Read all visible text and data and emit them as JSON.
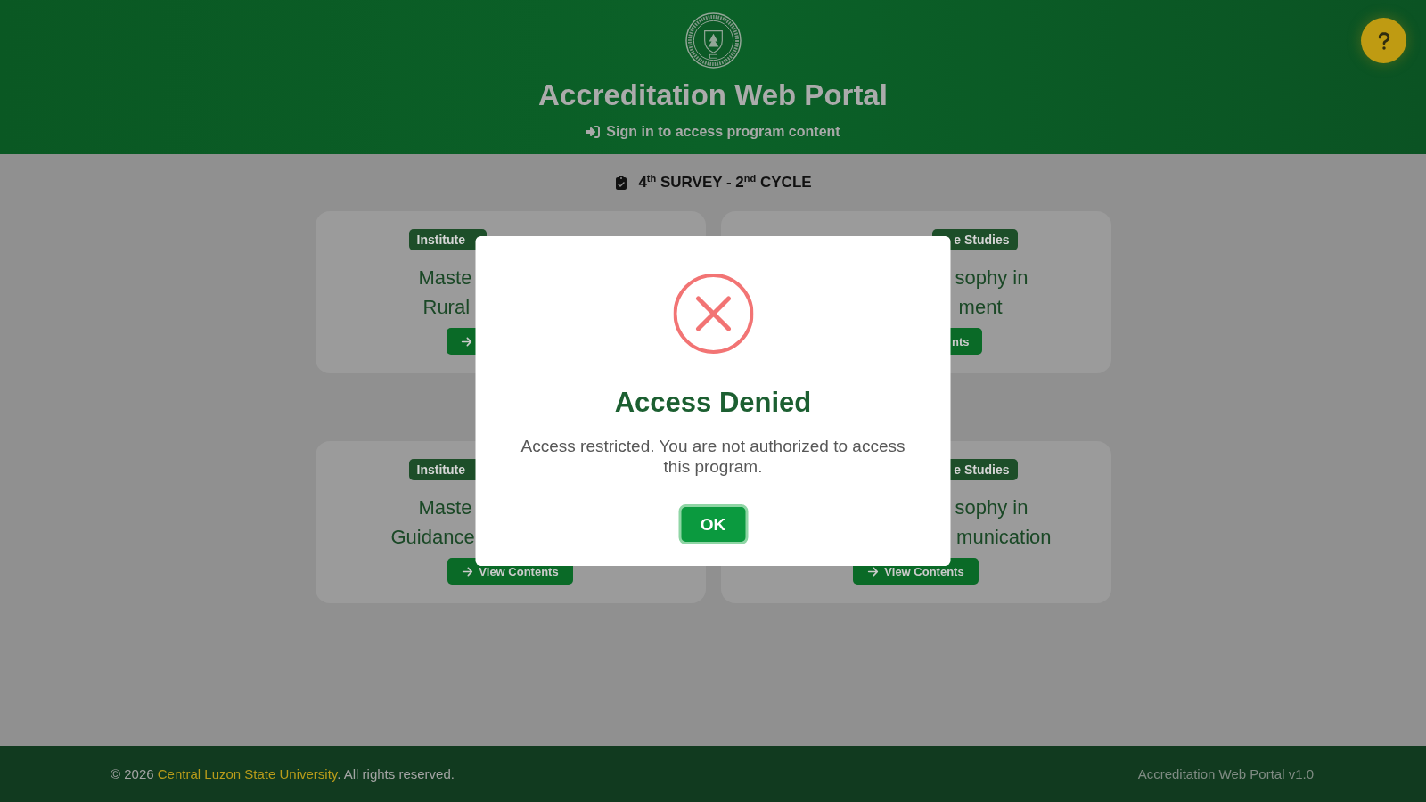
{
  "header": {
    "title": "Accreditation Web Portal",
    "subtitle": "Sign in to access program content"
  },
  "survey_heading": "4$^{th}$ SURVEY - 2$^{nd}$ CYCLE",
  "cards": [
    {
      "badge": "Institute",
      "title_lines": [
        "Maste",
        "Rural"
      ]
    },
    {
      "badge": "e Studies",
      "title_lines": [
        "sophy in",
        "ment"
      ],
      "button_label": "nts"
    },
    {
      "badge": "Institute",
      "title_lines": [
        "Maste",
        "Guidance"
      ],
      "button_label": "View Contents"
    },
    {
      "badge": "e Studies",
      "title_lines": [
        "sophy in",
        "munication"
      ],
      "button_label": "View Contents"
    }
  ],
  "dialog": {
    "title": "Access Denied",
    "message": "Access restricted. You are not authorized to access this program.",
    "confirm_label": "OK"
  },
  "footer": {
    "copyright": "© 2026",
    "link": "Central Luzon State University",
    "rights": ". All rights reserved.",
    "version": "Accreditation Web Portal v1.0"
  }
}
